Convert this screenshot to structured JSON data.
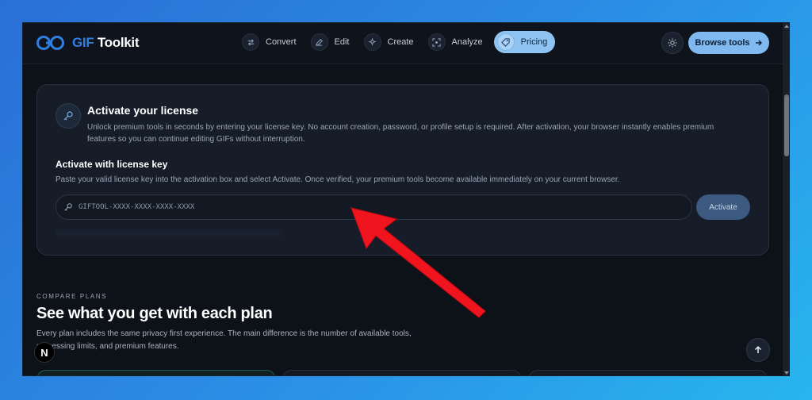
{
  "brand": {
    "name_part1": "GIF",
    "name_part2": " Toolkit"
  },
  "nav": {
    "items": [
      {
        "label": "Convert",
        "icon": "arrows-swap-icon"
      },
      {
        "label": "Edit",
        "icon": "pencil-icon"
      },
      {
        "label": "Create",
        "icon": "sparkle-icon"
      },
      {
        "label": "Analyze",
        "icon": "scan-icon"
      },
      {
        "label": "Pricing",
        "icon": "tag-icon",
        "active": true
      }
    ],
    "browse_label": "Browse tools"
  },
  "license": {
    "title": "Activate your license",
    "description": "Unlock premium tools in seconds by entering your license key. No account creation, password, or profile setup is required. After activation, your browser instantly enables premium features so you can continue editing GIFs without interruption.",
    "subtitle": "Activate with license key",
    "subdescription": "Paste your valid license key into the activation box and select Activate. Once verified, your premium tools become available immediately on your current browser.",
    "input_placeholder": "GIFTOOL-XXXX-XXXX-XXXX-XXXX",
    "activate_label": "Activate"
  },
  "plans": {
    "eyebrow": "COMPARE PLANS",
    "title": "See what you get with each plan",
    "description": "Every plan includes the same privacy first experience. The main difference is the number of available tools, processing limits, and premium features."
  },
  "colors": {
    "accent": "#8ec3f2",
    "brand_blue": "#2f7fe0",
    "annotation_red": "#f0141e",
    "background": "#0d1118"
  }
}
